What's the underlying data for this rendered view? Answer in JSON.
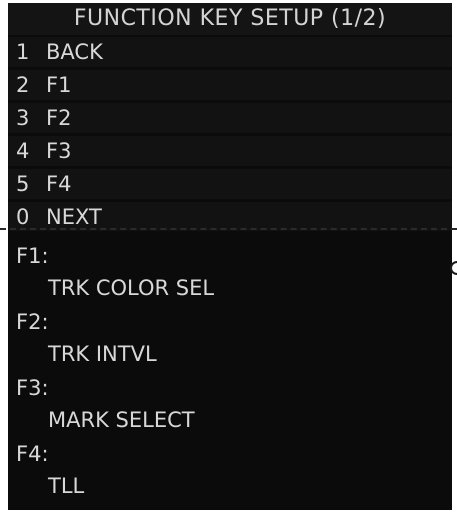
{
  "title": "FUNCTION KEY SETUP (1/2)",
  "menu": {
    "items": [
      {
        "num": "1",
        "label": "BACK"
      },
      {
        "num": "2",
        "label": "F1"
      },
      {
        "num": "3",
        "label": "F2"
      },
      {
        "num": "4",
        "label": "F3"
      },
      {
        "num": "5",
        "label": "F4"
      },
      {
        "num": "0",
        "label": "NEXT"
      }
    ]
  },
  "info": {
    "entries": [
      {
        "key": "F1:",
        "value": "TRK COLOR SEL"
      },
      {
        "key": "F2:",
        "value": "TRK INTVL"
      },
      {
        "key": "F3:",
        "value": "MARK SELECT"
      },
      {
        "key": "F4:",
        "value": "TLL"
      }
    ]
  }
}
